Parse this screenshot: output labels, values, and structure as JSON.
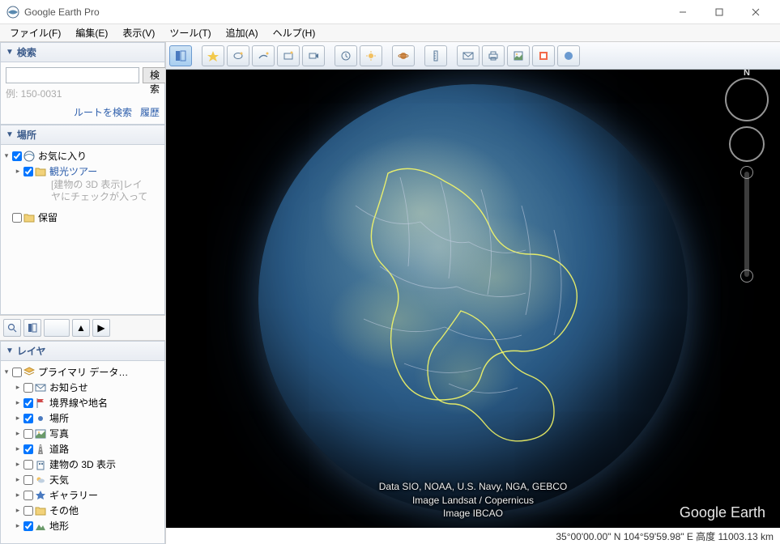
{
  "title": "Google Earth Pro",
  "menu": {
    "file": "ファイル(F)",
    "edit": "編集(E)",
    "view": "表示(V)",
    "tools": "ツール(T)",
    "add": "追加(A)",
    "help": "ヘルプ(H)"
  },
  "search": {
    "header": "検索",
    "button": "検索",
    "placeholder": "",
    "hint": "例: 150-0031",
    "route": "ルートを検索",
    "history": "履歴"
  },
  "places": {
    "header": "場所",
    "favorites": "お気に入り",
    "tour": "観光ツアー",
    "tour_desc1": "[建物の 3D 表示]レイ",
    "tour_desc2": "ヤにチェックが入って",
    "pending": "保留"
  },
  "layers": {
    "header": "レイヤ",
    "primary": "プライマリ データ…",
    "items": [
      {
        "label": "お知らせ",
        "checked": false,
        "icon": "mail"
      },
      {
        "label": "境界線や地名",
        "checked": true,
        "icon": "flag"
      },
      {
        "label": "場所",
        "checked": true,
        "icon": "dot"
      },
      {
        "label": "写真",
        "checked": false,
        "icon": "photo"
      },
      {
        "label": "道路",
        "checked": true,
        "icon": "road"
      },
      {
        "label": "建物の 3D 表示",
        "checked": false,
        "icon": "building"
      },
      {
        "label": "天気",
        "checked": false,
        "icon": "weather"
      },
      {
        "label": "ギャラリー",
        "checked": false,
        "icon": "star"
      },
      {
        "label": "その他",
        "checked": false,
        "icon": "folder"
      },
      {
        "label": "地形",
        "checked": true,
        "icon": "terrain"
      }
    ]
  },
  "attribution": {
    "line1": "Data SIO, NOAA, U.S. Navy, NGA, GEBCO",
    "line2": "Image Landsat / Copernicus",
    "line3": "Image IBCAO"
  },
  "watermark": "Google Earth",
  "status": "35°00'00.00\" N 104°59'59.98\" E 高度 11003.13 km",
  "nav": {
    "north": "N"
  }
}
